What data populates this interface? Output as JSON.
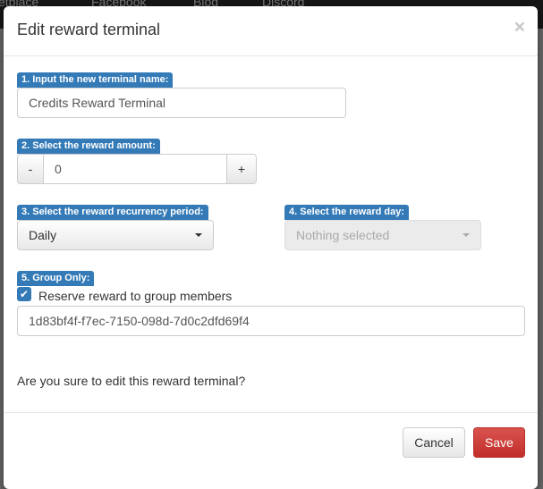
{
  "nav": [
    "etplace",
    "Facebook",
    "Blog",
    "Discord"
  ],
  "modal": {
    "title": "Edit reward terminal",
    "close": "×",
    "step1": {
      "label": "1. Input the new terminal name:",
      "value": "Credits Reward Terminal"
    },
    "step2": {
      "label": "2. Select the reward amount:",
      "minus": "-",
      "value": "0",
      "plus": "+"
    },
    "step3": {
      "label": "3. Select the reward recurrency period:",
      "selected": "Daily"
    },
    "step4": {
      "label": "4. Select the reward day:",
      "placeholder": "Nothing selected"
    },
    "step5": {
      "label": "5. Group Only:",
      "checkbox_label": "Reserve reward to group members",
      "checked": true,
      "group_id": "1d83bf4f-f7ec-7150-098d-7d0c2dfd69f4"
    },
    "confirm": "Are you sure to edit this reward terminal?",
    "cancel": "Cancel",
    "save": "Save"
  },
  "colors": {
    "label_bg": "#337ab7",
    "save_bg": "#d9534f"
  }
}
